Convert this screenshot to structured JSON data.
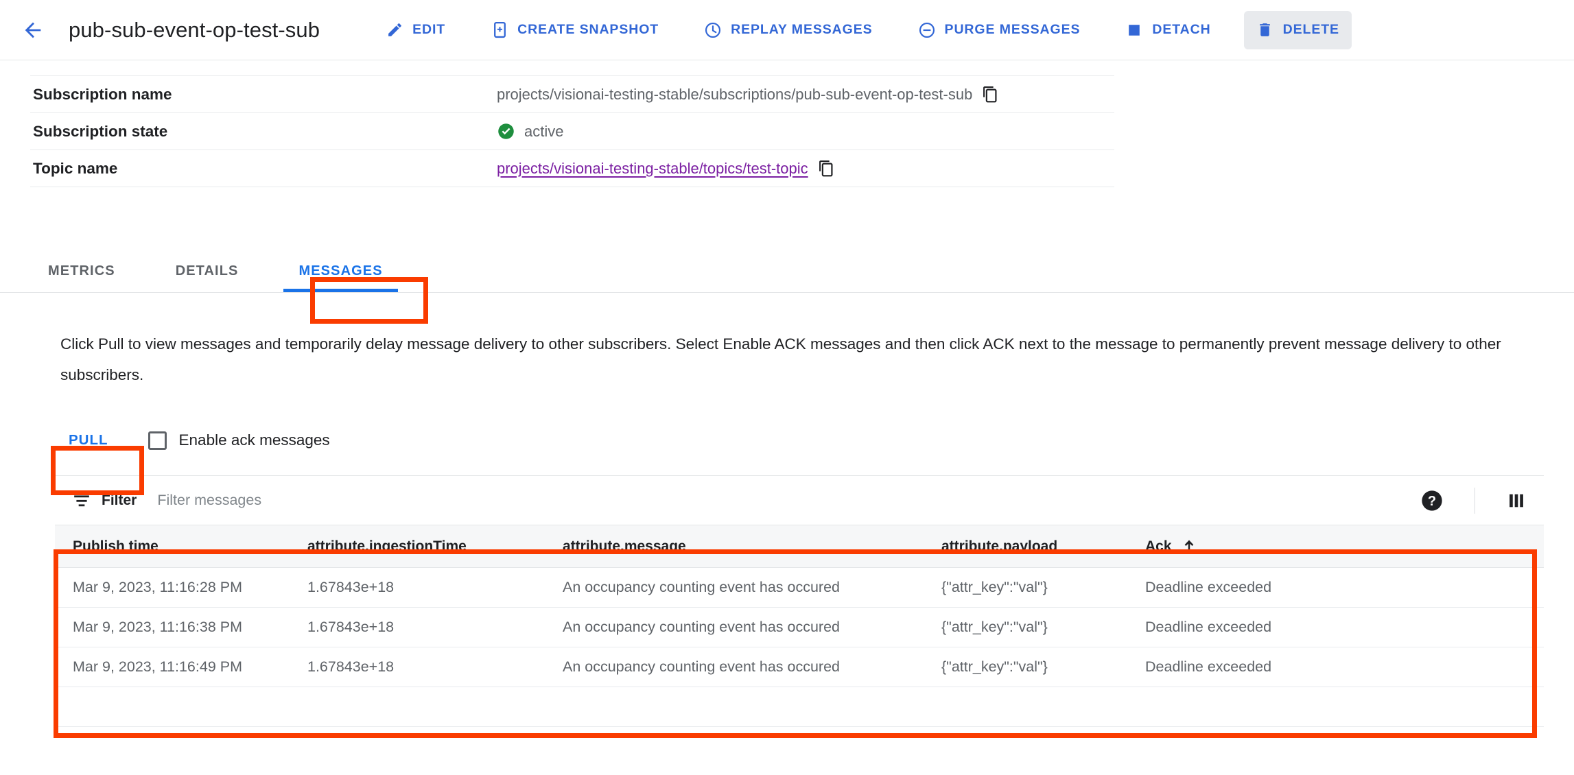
{
  "header": {
    "back_icon": "arrow-left-icon",
    "title": "pub-sub-event-op-test-sub",
    "actions": [
      {
        "label": "EDIT",
        "icon": "pencil-icon",
        "active": false
      },
      {
        "label": "CREATE SNAPSHOT",
        "icon": "snapshot-icon",
        "active": false
      },
      {
        "label": "REPLAY MESSAGES",
        "icon": "clock-icon",
        "active": false
      },
      {
        "label": "PURGE MESSAGES",
        "icon": "minus-circle-icon",
        "active": false
      },
      {
        "label": "DETACH",
        "icon": "square-icon",
        "active": false
      },
      {
        "label": "DELETE",
        "icon": "trash-icon",
        "active": true
      }
    ]
  },
  "details": {
    "rows": [
      {
        "label": "Subscription name",
        "value": "projects/visionai-testing-stable/subscriptions/pub-sub-event-op-test-sub",
        "type": "text-copy",
        "copy_icon": "copy-icon"
      },
      {
        "label": "Subscription state",
        "value": "active",
        "type": "status",
        "status_icon": "check-circle-icon",
        "status_color": "#1e8e3e"
      },
      {
        "label": "Topic name",
        "value": "projects/visionai-testing-stable/topics/test-topic",
        "type": "link-copy",
        "link_color": "#7b1fa2",
        "copy_icon": "copy-icon"
      }
    ]
  },
  "tabs": [
    {
      "label": "METRICS",
      "active": false
    },
    {
      "label": "DETAILS",
      "active": false
    },
    {
      "label": "MESSAGES",
      "active": true
    }
  ],
  "messages_panel": {
    "description": "Click Pull to view messages and temporarily delay message delivery to other subscribers. Select Enable ACK messages and then click ACK next to the message to permanently prevent message delivery to other subscribers.",
    "pull_button": "PULL",
    "ack_checkbox_label": "Enable ack messages",
    "ack_checkbox_checked": false,
    "filter": {
      "icon": "filter-icon",
      "label": "Filter",
      "placeholder": "Filter messages",
      "value": "",
      "help_icon": "help-circle-icon",
      "columns_icon": "column-settings-icon"
    },
    "table": {
      "columns": [
        {
          "label": "Publish time",
          "sorted": false
        },
        {
          "label": "attribute.ingestionTime",
          "sorted": false
        },
        {
          "label": "attribute.message",
          "sorted": false
        },
        {
          "label": "attribute.payload",
          "sorted": false
        },
        {
          "label": "Ack",
          "sorted": true,
          "sort_icon": "arrow-up-icon"
        }
      ],
      "rows": [
        {
          "publish_time": "Mar 9, 2023, 11:16:28 PM",
          "ingestion_time": "1.67843e+18",
          "message": "An occupancy counting event has occured",
          "payload": "{\"attr_key\":\"val\"}",
          "ack": "Deadline exceeded"
        },
        {
          "publish_time": "Mar 9, 2023, 11:16:38 PM",
          "ingestion_time": "1.67843e+18",
          "message": "An occupancy counting event has occured",
          "payload": "{\"attr_key\":\"val\"}",
          "ack": "Deadline exceeded"
        },
        {
          "publish_time": "Mar 9, 2023, 11:16:49 PM",
          "ingestion_time": "1.67843e+18",
          "message": "An occupancy counting event has occured",
          "payload": "{\"attr_key\":\"val\"}",
          "ack": "Deadline exceeded"
        }
      ]
    }
  },
  "annotations": {
    "highlight_color": "#fa3c00",
    "boxes": [
      {
        "name": "messages-tab-highlight"
      },
      {
        "name": "pull-button-highlight"
      },
      {
        "name": "messages-table-highlight"
      }
    ]
  }
}
